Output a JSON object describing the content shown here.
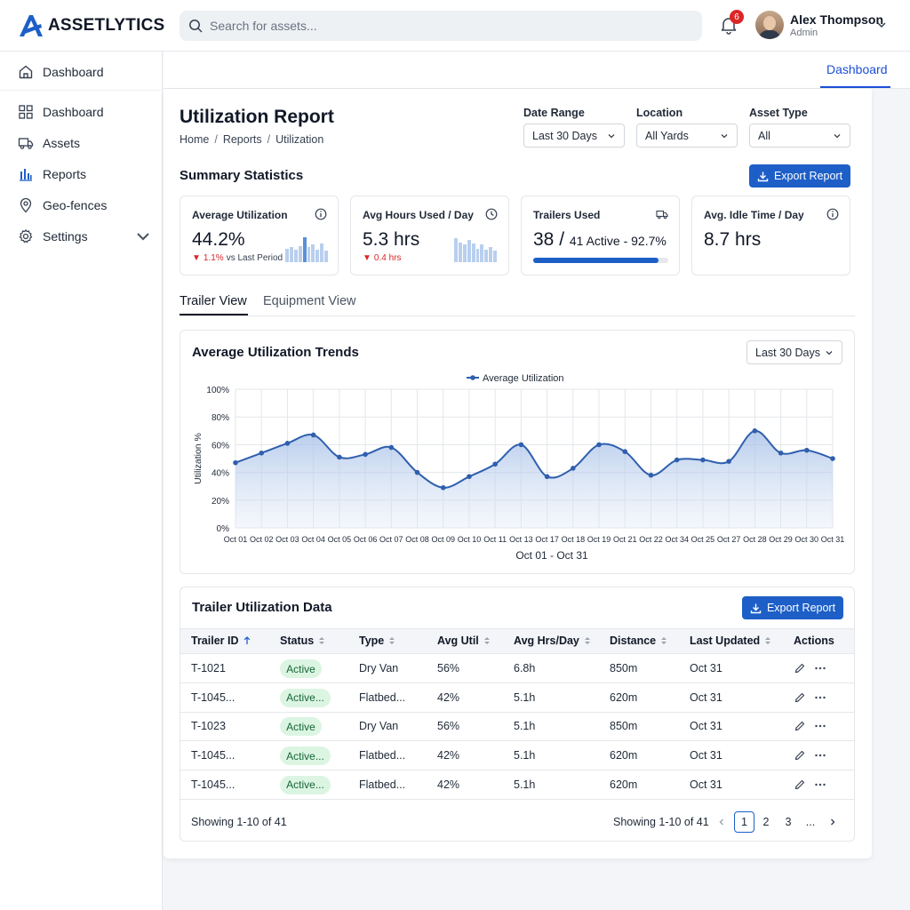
{
  "app": {
    "name": "ASSETLYTICS",
    "brand_color": "#1d5fc7"
  },
  "header": {
    "search_placeholder": "Search for assets...",
    "notification_count": "6",
    "user_name": "Alex Thompson",
    "user_role": "Admin"
  },
  "sidebar": {
    "top_item": "Dashboard",
    "items": [
      {
        "label": "Dashboard",
        "icon": "grid-icon"
      },
      {
        "label": "Assets",
        "icon": "truck-icon"
      },
      {
        "label": "Reports",
        "icon": "bar-chart-icon"
      },
      {
        "label": "Geo-fences",
        "icon": "map-pin-icon"
      },
      {
        "label": "Settings",
        "icon": "gear-icon"
      }
    ]
  },
  "top_tab": "Dashboard",
  "page": {
    "title": "Utilization Report",
    "breadcrumb": [
      "Home",
      "Reports",
      "Utilization"
    ]
  },
  "filters": {
    "date_range": {
      "label": "Date Range",
      "value": "Last 30 Days"
    },
    "location": {
      "label": "Location",
      "value": "All Yards"
    },
    "asset_type": {
      "label": "Asset Type",
      "value": "All"
    }
  },
  "summary": {
    "title": "Summary Statistics",
    "export_label": "Export Report",
    "cards": [
      {
        "label": "Average Utilization",
        "value": "44.2%",
        "delta": "1.1%",
        "delta_suffix": "vs Last Period",
        "icon": "info-icon"
      },
      {
        "label": "Avg Hours Used / Day",
        "value": "5.3 hrs",
        "delta": "0.4 hrs",
        "icon": "clock-icon"
      },
      {
        "label": "Trailers Used",
        "value_main": "38 /",
        "value_sub": "41 Active - 92.7%",
        "progress": 0.927,
        "icon": "truck-icon"
      },
      {
        "label": "Avg. Idle Time / Day",
        "value": "8.7 hrs",
        "icon": "info-icon"
      }
    ]
  },
  "view_tabs": {
    "active": "Trailer View",
    "inactive": "Equipment View"
  },
  "chart": {
    "title": "Average Utilization Trends",
    "range_select": "Last 30 Days",
    "x_caption": "Oct 01 - Oct 31",
    "line_color": "#2f5fae",
    "chart_data": {
      "type": "area",
      "title": "Average Utilization Trends",
      "xlabel": "Oct 01 - Oct 31",
      "ylabel": "Utilization %",
      "ylim": [
        0,
        100
      ],
      "yticks": [
        "0%",
        "20%",
        "40%",
        "60%",
        "80%",
        "100%"
      ],
      "grid": true,
      "legend_position": "top",
      "categories": [
        "Oct 01",
        "Oct 02",
        "Oct 03",
        "Oct 04",
        "Oct 05",
        "Oct 06",
        "Oct 07",
        "Oct 08",
        "Oct 09",
        "Oct 10",
        "Oct 11",
        "Oct 13",
        "Oct 17",
        "Oct 18",
        "Oct 19",
        "Oct 21",
        "Oct 22",
        "Oct 34",
        "Oct 25",
        "Oct 27",
        "Oct 28",
        "Oct 29",
        "Oct 30",
        "Oct 31"
      ],
      "series": [
        {
          "name": "Average Utilization",
          "values": [
            47,
            54,
            61,
            67,
            51,
            53,
            58,
            40,
            29,
            37,
            46,
            60,
            37,
            43,
            60,
            55,
            38,
            49,
            49,
            48,
            70,
            54,
            56,
            50
          ]
        }
      ]
    }
  },
  "table": {
    "title": "Trailer Utilization Data",
    "export_label": "Export Report",
    "columns": [
      "Trailer ID",
      "Status",
      "Type",
      "Avg Util",
      "Avg Hrs/Day",
      "Distance",
      "Last Updated",
      "Actions"
    ],
    "rows": [
      {
        "id": "T-1021",
        "status": "Active",
        "type": "Dry Van",
        "util": "56%",
        "hrs": "6.8h",
        "distance": "850m",
        "updated": "Oct 31"
      },
      {
        "id": "T-1045...",
        "status": "Active...",
        "type": "Flatbed...",
        "util": "42%",
        "hrs": "5.1h",
        "distance": "620m",
        "updated": "Oct 31"
      },
      {
        "id": "T-1023",
        "status": "Active",
        "type": "Dry Van",
        "util": "56%",
        "hrs": "5.1h",
        "distance": "850m",
        "updated": "Oct 31"
      },
      {
        "id": "T-1045...",
        "status": "Active...",
        "type": "Flatbed...",
        "util": "42%",
        "hrs": "5.1h",
        "distance": "620m",
        "updated": "Oct 31"
      },
      {
        "id": "T-1045...",
        "status": "Active...",
        "type": "Flatbed...",
        "util": "42%",
        "hrs": "5.1h",
        "distance": "620m",
        "updated": "Oct 31"
      }
    ],
    "footer_left": "Showing 1-10 of 41",
    "footer_right": "Showing 1-10 of 41",
    "pages": [
      "1",
      "2",
      "3",
      "..."
    ],
    "current_page": "1"
  }
}
